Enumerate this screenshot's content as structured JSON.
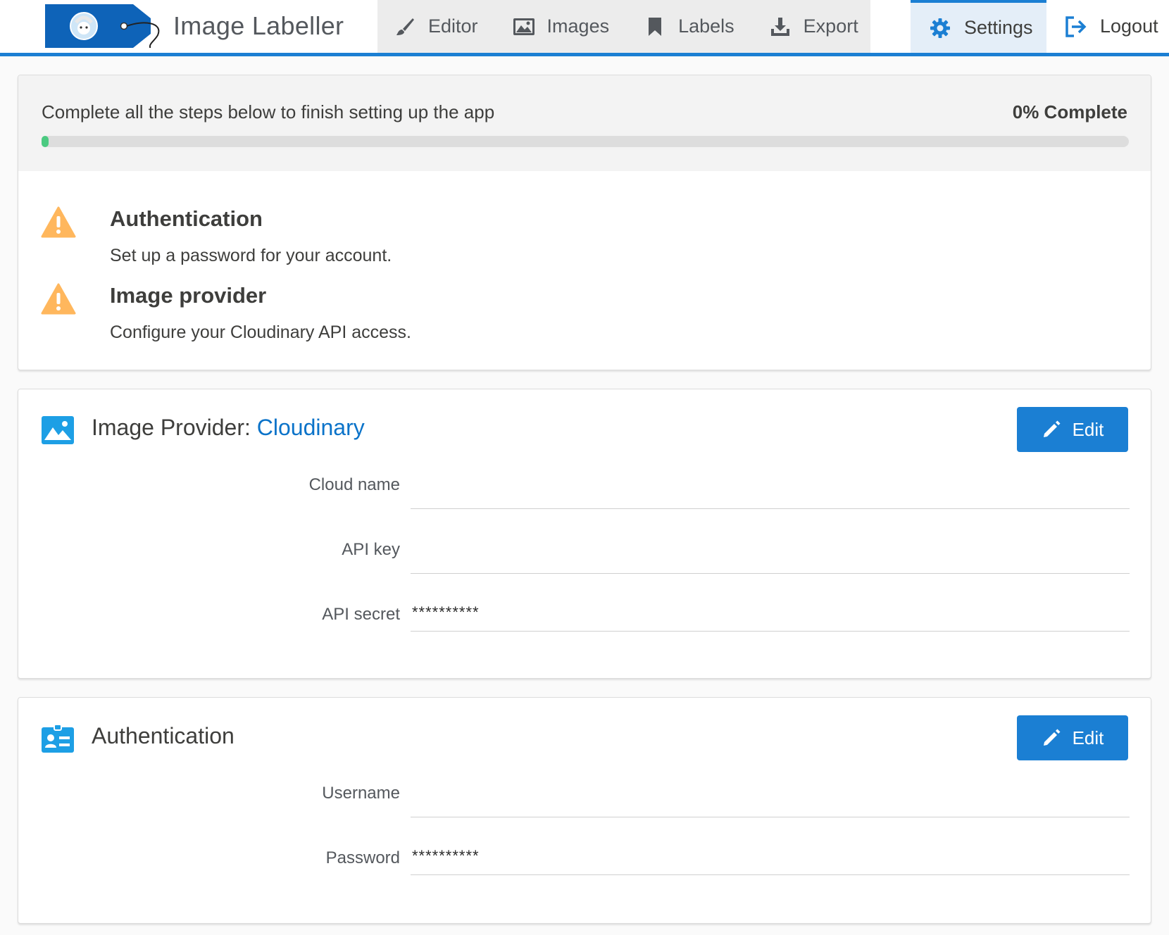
{
  "app": {
    "title": "Image Labeller",
    "accent_color": "#1b7fd3",
    "warning_color": "#ffb75d",
    "success_color": "#4bca81"
  },
  "nav": {
    "items": [
      {
        "label": "Editor",
        "icon": "paintbrush-icon"
      },
      {
        "label": "Images",
        "icon": "image-icon"
      },
      {
        "label": "Labels",
        "icon": "bookmark-icon"
      },
      {
        "label": "Export",
        "icon": "download-icon"
      }
    ],
    "settings": {
      "label": "Settings",
      "icon": "gear-icon",
      "active": true
    },
    "logout": {
      "label": "Logout",
      "icon": "logout-icon"
    }
  },
  "setup": {
    "message": "Complete all the steps below to finish setting up the app",
    "percent_label": "0% Complete",
    "progress": 0,
    "steps": [
      {
        "title": "Authentication",
        "description": "Set up a password for your account.",
        "icon": "warning-icon"
      },
      {
        "title": "Image provider",
        "description": "Configure your Cloudinary API access.",
        "icon": "warning-icon"
      }
    ]
  },
  "provider_card": {
    "title": "Image Provider: ",
    "provider_name": "Cloudinary",
    "edit_label": "Edit",
    "fields": [
      {
        "label": "Cloud name",
        "value": ""
      },
      {
        "label": "API key",
        "value": ""
      },
      {
        "label": "API secret",
        "value": "**********"
      }
    ]
  },
  "auth_card": {
    "title": "Authentication",
    "edit_label": "Edit",
    "fields": [
      {
        "label": "Username",
        "value": ""
      },
      {
        "label": "Password",
        "value": "**********"
      }
    ]
  }
}
